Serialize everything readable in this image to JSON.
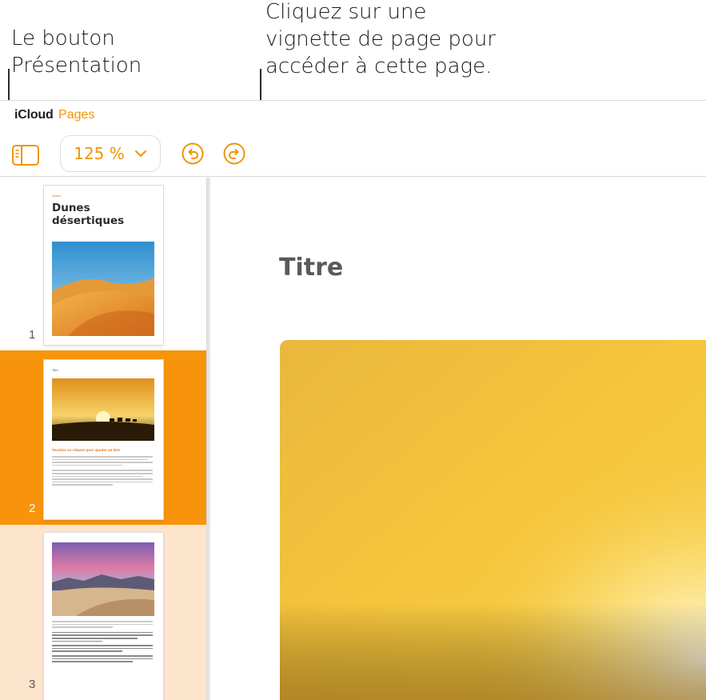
{
  "callouts": {
    "view_button": "Le bouton\nPrésentation",
    "thumbnail": "Cliquez sur une\nvignette de page pour\naccéder à cette page."
  },
  "app": {
    "brand": "iCloud",
    "product": "Pages",
    "accent_color": "#f19500"
  },
  "toolbar": {
    "view_icon": "sidebar-icon",
    "zoom_value": "125 %",
    "zoom_icon": "chevron-down-icon",
    "undo_icon": "undo-icon",
    "redo_icon": "redo-icon"
  },
  "sidebar": {
    "pages": [
      {
        "number": "1",
        "author": "Auteur",
        "title": "Dunes désertiques",
        "image": "desert-dunes-image",
        "state": "normal"
      },
      {
        "number": "2",
        "label": "Titre",
        "heading": "Touchez ou cliquez pour ajouter un titre",
        "image": "desert-sunset-camels-image",
        "state": "selected"
      },
      {
        "number": "3",
        "image": "desert-pink-sky-image",
        "state": "hover"
      }
    ],
    "selected_color": "#f7940c",
    "hover_color": "#fde4cc"
  },
  "canvas": {
    "title": "Titre",
    "image": "golden-gradient-image"
  }
}
